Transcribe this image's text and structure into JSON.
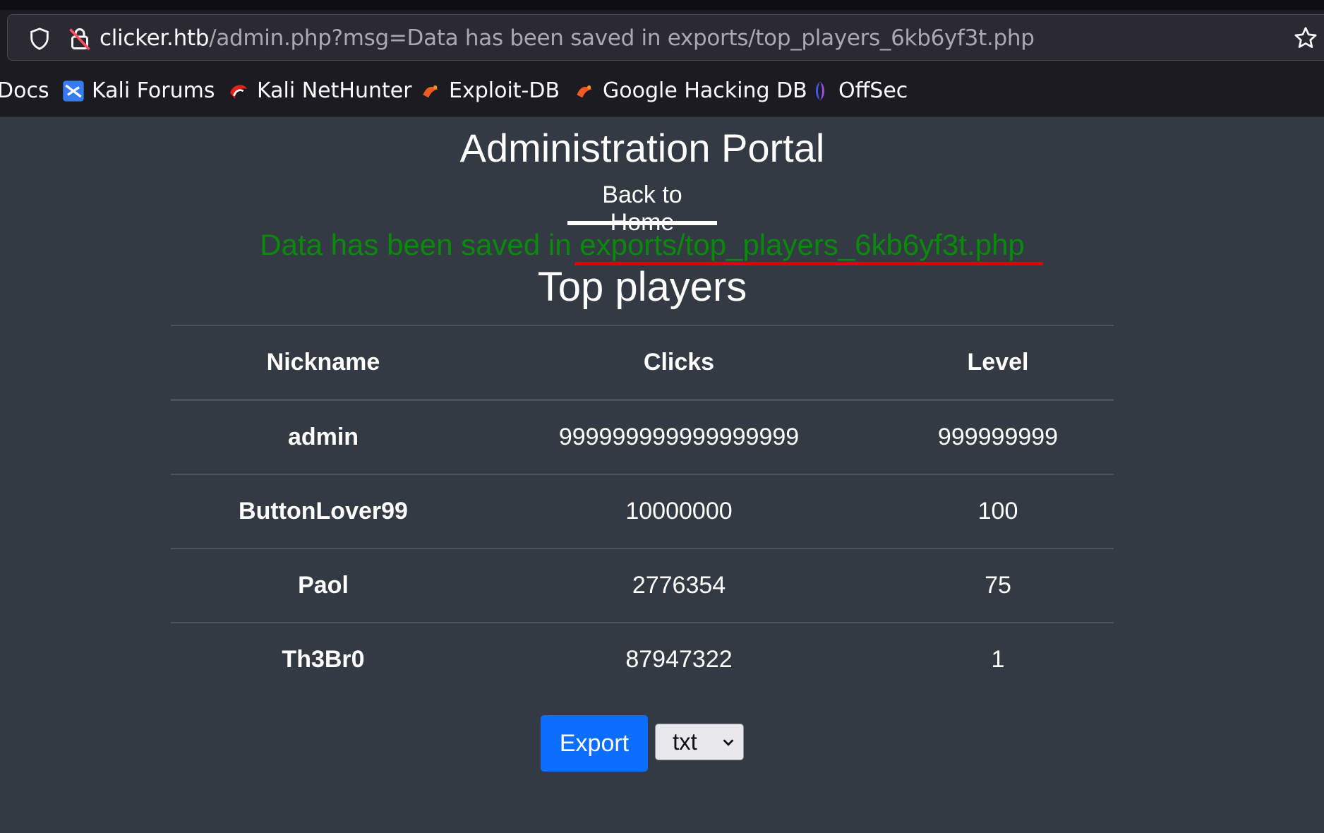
{
  "browser": {
    "url_domain": "clicker.htb",
    "url_path": "/admin.php?msg=Data has been saved in exports/top_players_6kb6yf3t.php",
    "bookmarks": [
      {
        "label": "Docs",
        "icon": "none"
      },
      {
        "label": "Kali Forums",
        "icon": "kali-forums-icon"
      },
      {
        "label": "Kali NetHunter",
        "icon": "kali-nethunter-icon"
      },
      {
        "label": "Exploit-DB",
        "icon": "exploit-db-icon"
      },
      {
        "label": "Google Hacking DB",
        "icon": "ghdb-icon"
      },
      {
        "label": "OffSec",
        "icon": "offsec-icon"
      }
    ]
  },
  "page": {
    "title": "Administration Portal",
    "back_link": "Back to Home",
    "message": "Data has been saved in exports/top_players_6kb6yf3t.php",
    "section_title": "Top players"
  },
  "table": {
    "headers": [
      "Nickname",
      "Clicks",
      "Level"
    ],
    "rows": [
      {
        "nickname": "admin",
        "clicks": "999999999999999999",
        "level": "999999999"
      },
      {
        "nickname": "ButtonLover99",
        "clicks": "10000000",
        "level": "100"
      },
      {
        "nickname": "Paol",
        "clicks": "2776354",
        "level": "75"
      },
      {
        "nickname": "Th3Br0",
        "clicks": "87947322",
        "level": "1"
      }
    ]
  },
  "export": {
    "button_label": "Export",
    "format_selected": "txt"
  },
  "colors": {
    "message_green": "#0a8a0a",
    "annotation_red": "#e00000",
    "export_blue": "#0d6efd",
    "page_bg": "#343a44"
  }
}
